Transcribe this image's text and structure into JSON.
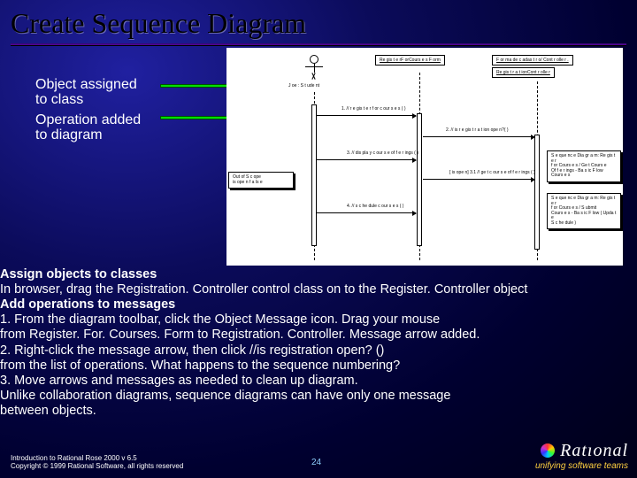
{
  "title": "Create Sequence Diagram",
  "notes": {
    "n1a": "Object assigned",
    "n1b": "to class",
    "n2a": "Operation added",
    "n2b": "to diagram"
  },
  "diagram": {
    "actor_label": "J oe : S t ude nt",
    "obj1": "Re gis t e rF orCours e s F orm",
    "obj2": "F or ma de c adas t r o/ Cont r olle r .",
    "obj3": "Re gis t r a t ionCont r olle r",
    "msg1": "1. // r e gis t e r f or c our s e s ( )",
    "msg2": "2. // is r e gis t r a t ion ope n?( )",
    "msg3": "3. // dis pla y c our s e of f e r ings ( )",
    "msg4": "[ is ope n] 3.1 // ge t c our s e of f e r ings ( )",
    "msg5": "4. // s c he dule c our s e s ( )",
    "sb1_l1": "Out of S c ope",
    "sb1_l2": "is ope n f a ls e",
    "sb2_l1": "S e que nc e  Dia gr a m:  Re gis t e r",
    "sb2_l2": "f or  Cours e s  /  Ge t  Cours e",
    "sb2_l3": "Of f e r ings  -  Ba s ic  F low",
    "sb2_l4": "Cours e s",
    "sb3_l1": "S e que nc e  Dia gr a m:  Re gis t e r",
    "sb3_l2": "f or  Cours e s  /  S ubmit",
    "sb3_l3": "Cours e s  -  Ba s ic  F low  ( Upda t e",
    "sb3_l4": "S c he dule )"
  },
  "body": {
    "h1": "Assign objects to classes",
    "p1": "In browser, drag the Registration. Controller control class on to the Register. Controller object",
    "h2": "Add operations to messages",
    "p2a": "1.    From the diagram toolbar, click the Object Message icon. Drag your mouse",
    "p2b": "from Register. For. Courses. Form to Registration. Controller.  Message arrow added.",
    "p3a": "2. Right-click the message arrow, then click //is registration open? ()",
    "p3b": " from the list of operations. What happens to the sequence numbering?",
    "p4a": "3.    Move arrows and messages as needed to clean up diagram.",
    "p4b": "Unlike collaboration diagrams, sequence diagrams can have only one message",
    "p4c": "between objects."
  },
  "footer": {
    "l1": "Introduction to Rational Rose 2000 v 6.5",
    "l2": "Copyright © 1999 Rational Software, all rights reserved"
  },
  "page": "24",
  "logo": {
    "brand": "Ratıonal",
    "tag": "unifying software teams"
  }
}
